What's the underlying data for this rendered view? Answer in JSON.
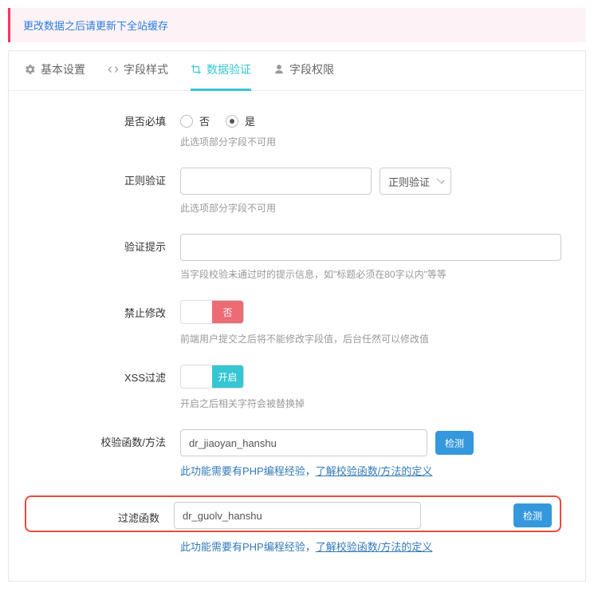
{
  "alert": "更改数据之后请更新下全站缓存",
  "tabs": {
    "basic": "基本设置",
    "style": "字段样式",
    "validate": "数据验证",
    "permission": "字段权限"
  },
  "fields": {
    "required": {
      "label": "是否必填",
      "no": "否",
      "yes": "是",
      "help": "此选项部分字段不可用"
    },
    "regex": {
      "label": "正则验证",
      "value": "",
      "select": "正则验证",
      "help": "此选项部分字段不可用"
    },
    "tip": {
      "label": "验证提示",
      "value": "",
      "help": "当字段校验未通过时的提示信息，如\"标题必须在80字以内\"等等"
    },
    "forbid": {
      "label": "禁止修改",
      "switch": "否",
      "help": "前端用户提交之后将不能修改字段值，后台任然可以修改值"
    },
    "xss": {
      "label": "XSS过滤",
      "switch": "开启",
      "help": "开启之后相关字符会被替换掉"
    },
    "checkfn": {
      "label": "校验函数/方法",
      "value": "dr_jiaoyan_hanshu",
      "btn": "检测",
      "help1": "此功能需要有PHP编程经验，",
      "help2": "了解校验函数/方法的定义"
    },
    "filterfn": {
      "label": "过滤函数",
      "value": "dr_guolv_hanshu",
      "btn": "检测",
      "help1": "此功能需要有PHP编程经验，",
      "help2": "了解校验函数/方法的定义"
    }
  }
}
